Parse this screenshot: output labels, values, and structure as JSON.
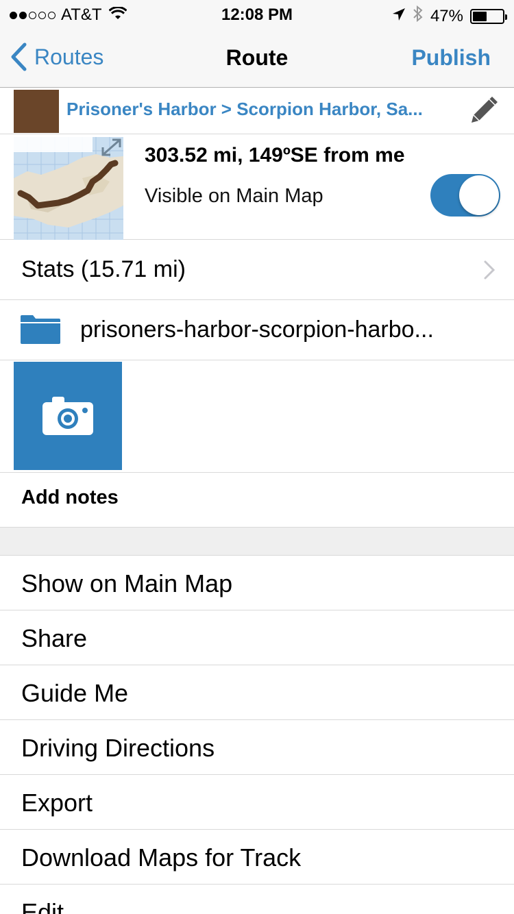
{
  "status_bar": {
    "carrier": "AT&T",
    "signal_bars_filled": 2,
    "signal_bars_total": 5,
    "time": "12:08 PM",
    "battery_percent": "47%",
    "battery_level": 0.47
  },
  "nav": {
    "back_label": "Routes",
    "title": "Route",
    "publish_label": "Publish"
  },
  "route": {
    "name": "Prisoner's Harbor > Scorpion Harbor, Sa...",
    "color": "#6a4529",
    "distance_bearing": "303.52 mi, 149ºSE from me",
    "visible_label": "Visible on Main Map",
    "visible_on": true,
    "stats_label": "Stats (15.71 mi)",
    "folder_name": "prisoners-harbor-scorpion-harbo...",
    "add_notes_label": "Add notes"
  },
  "actions": [
    {
      "label": "Show on Main Map"
    },
    {
      "label": "Share"
    },
    {
      "label": "Guide Me"
    },
    {
      "label": "Driving Directions"
    },
    {
      "label": "Export"
    },
    {
      "label": "Download Maps for Track"
    },
    {
      "label": "Edit"
    }
  ],
  "colors": {
    "accent": "#3a86c3",
    "toggle_on": "#2f80bd",
    "route_track": "#5a3a22"
  }
}
